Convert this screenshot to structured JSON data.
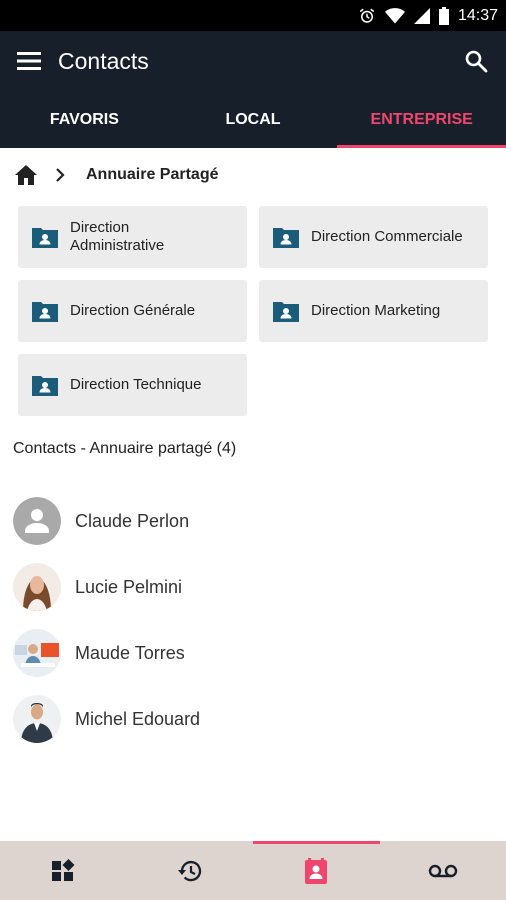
{
  "status_bar": {
    "time": "14:37"
  },
  "app_bar": {
    "title": "Contacts"
  },
  "tabs": [
    {
      "label": "FAVORIS",
      "active": false
    },
    {
      "label": "LOCAL",
      "active": false
    },
    {
      "label": "ENTREPRISE",
      "active": true
    }
  ],
  "breadcrumb": {
    "current": "Annuaire Partagé"
  },
  "folders": [
    {
      "label": "Direction Administrative"
    },
    {
      "label": "Direction Commerciale"
    },
    {
      "label": "Direction Générale"
    },
    {
      "label": "Direction Marketing"
    },
    {
      "label": "Direction Technique"
    }
  ],
  "contacts_section": {
    "title": "Contacts - Annuaire partagé (4)"
  },
  "contacts": [
    {
      "name": "Claude Perlon",
      "avatar": "default-person-icon"
    },
    {
      "name": "Lucie Pelmini",
      "avatar": "photo"
    },
    {
      "name": "Maude Torres",
      "avatar": "photo"
    },
    {
      "name": "Michel Edouard",
      "avatar": "photo"
    }
  ],
  "bottom_nav": [
    {
      "icon": "dashboard-icon",
      "active": false
    },
    {
      "icon": "history-icon",
      "active": false
    },
    {
      "icon": "contacts-icon",
      "active": true
    },
    {
      "icon": "voicemail-icon",
      "active": false
    }
  ],
  "colors": {
    "appbar": "#17202a",
    "accent": "#f0466e",
    "folder_icon": "#1a5c7a",
    "folder_bg": "#ececec",
    "bottom_nav_bg": "#ddd3cf"
  }
}
